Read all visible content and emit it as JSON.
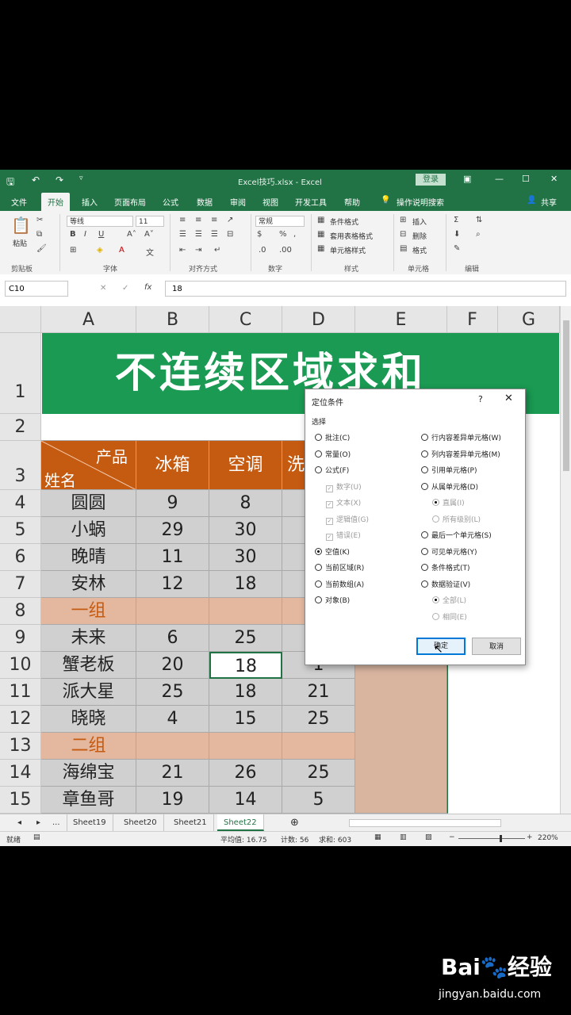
{
  "app": {
    "window_title": "Excel技巧.xlsx - Excel",
    "login_label": "登录",
    "share_label": "共享"
  },
  "tabs": [
    "文件",
    "开始",
    "插入",
    "页面布局",
    "公式",
    "数据",
    "审阅",
    "视图",
    "开发工具",
    "帮助",
    "操作说明搜索"
  ],
  "active_tab": "开始",
  "ribbon": {
    "paste_label": "粘贴",
    "font_name": "等线",
    "font_size": "11",
    "number_format": "常规",
    "groups": [
      "剪贴板",
      "字体",
      "对齐方式",
      "数字",
      "样式",
      "单元格",
      "编辑"
    ],
    "styles_items": [
      "条件格式",
      "套用表格格式",
      "单元格样式"
    ],
    "cells_items": [
      "插入",
      "删除",
      "格式"
    ]
  },
  "formula_bar": {
    "name_box": "C10",
    "formula": "18"
  },
  "columns": [
    "A",
    "B",
    "C",
    "D",
    "E",
    "F",
    "G"
  ],
  "rows": [
    "1",
    "2",
    "3",
    "4",
    "5",
    "6",
    "7",
    "8",
    "9",
    "10",
    "11",
    "12",
    "13",
    "14",
    "15"
  ],
  "sheet": {
    "title": "不连续区域求和",
    "header_product": "产品",
    "header_name": "姓名",
    "headers": [
      "冰箱",
      "空调",
      "洗"
    ],
    "data": [
      [
        "圆圆",
        "9",
        "8",
        ""
      ],
      [
        "小蜗",
        "29",
        "30",
        ""
      ],
      [
        "晚晴",
        "11",
        "30",
        ""
      ],
      [
        "安林",
        "12",
        "18",
        ""
      ],
      [
        "一组",
        "",
        "",
        ""
      ],
      [
        "未来",
        "6",
        "25",
        ""
      ],
      [
        "蟹老板",
        "20",
        "18",
        "1"
      ],
      [
        "派大星",
        "25",
        "18",
        "21"
      ],
      [
        "晓晓",
        "4",
        "15",
        "25"
      ],
      [
        "二组",
        "",
        "",
        ""
      ],
      [
        "海绵宝",
        "21",
        "26",
        "25"
      ],
      [
        "章鱼哥",
        "19",
        "14",
        "5"
      ]
    ]
  },
  "sheet_tabs": [
    "...",
    "Sheet19",
    "Sheet20",
    "Sheet21",
    "Sheet22"
  ],
  "active_sheet": "Sheet22",
  "status": {
    "ready": "就绪",
    "average": "平均值: 16.75",
    "count": "计数: 56",
    "sum": "求和: 603",
    "zoom": "220%"
  },
  "dialog": {
    "title": "定位条件",
    "help": "?",
    "section": "选择",
    "left_options": [
      {
        "label": "批注(C)",
        "type": "radio",
        "on": false,
        "disabled": false
      },
      {
        "label": "常量(O)",
        "type": "radio",
        "on": false,
        "disabled": false
      },
      {
        "label": "公式(F)",
        "type": "radio",
        "on": false,
        "disabled": false
      },
      {
        "label": "数字(U)",
        "type": "check",
        "on": true,
        "disabled": true
      },
      {
        "label": "文本(X)",
        "type": "check",
        "on": true,
        "disabled": true
      },
      {
        "label": "逻辑值(G)",
        "type": "check",
        "on": true,
        "disabled": true
      },
      {
        "label": "错误(E)",
        "type": "check",
        "on": true,
        "disabled": true
      },
      {
        "label": "空值(K)",
        "type": "radio",
        "on": true,
        "disabled": false
      },
      {
        "label": "当前区域(R)",
        "type": "radio",
        "on": false,
        "disabled": false
      },
      {
        "label": "当前数组(A)",
        "type": "radio",
        "on": false,
        "disabled": false
      },
      {
        "label": "对象(B)",
        "type": "radio",
        "on": false,
        "disabled": false
      }
    ],
    "right_options": [
      {
        "label": "行内容差异单元格(W)",
        "type": "radio",
        "on": false,
        "disabled": false
      },
      {
        "label": "列内容差异单元格(M)",
        "type": "radio",
        "on": false,
        "disabled": false
      },
      {
        "label": "引用单元格(P)",
        "type": "radio",
        "on": false,
        "disabled": false
      },
      {
        "label": "从属单元格(D)",
        "type": "radio",
        "on": false,
        "disabled": false
      },
      {
        "label": "直属(I)",
        "type": "radio",
        "on": true,
        "disabled": true
      },
      {
        "label": "所有级别(L)",
        "type": "radio",
        "on": false,
        "disabled": true
      },
      {
        "label": "最后一个单元格(S)",
        "type": "radio",
        "on": false,
        "disabled": false
      },
      {
        "label": "可见单元格(Y)",
        "type": "radio",
        "on": false,
        "disabled": false
      },
      {
        "label": "条件格式(T)",
        "type": "radio",
        "on": false,
        "disabled": false
      },
      {
        "label": "数据验证(V)",
        "type": "radio",
        "on": false,
        "disabled": false
      },
      {
        "label": "全部(L)",
        "type": "radio",
        "on": true,
        "disabled": true
      },
      {
        "label": "相同(E)",
        "type": "radio",
        "on": false,
        "disabled": true
      }
    ],
    "ok_label": "确定",
    "cancel_label": "取消"
  },
  "watermark": {
    "brand": "Bai",
    "brand2": "经验",
    "url": "jingyan.baidu.com"
  }
}
